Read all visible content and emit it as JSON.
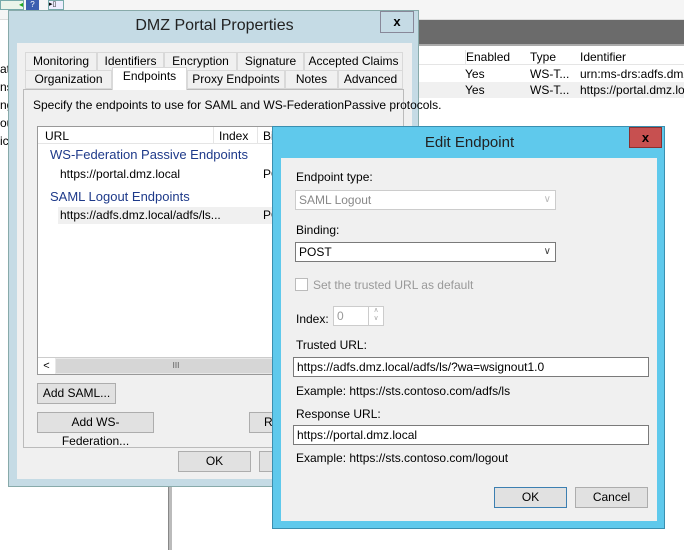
{
  "background": {
    "toolbar_icons": [
      "back-arrow-icon",
      "help-icon",
      "show-pane-icon"
    ],
    "left_fragments": [
      "at",
      "ns",
      "ng",
      "ou",
      "ic"
    ],
    "table": {
      "columns": [
        "Enabled",
        "Type",
        "Identifier"
      ],
      "rows": [
        [
          "Yes",
          "WS-T...",
          "urn:ms-drs:adfs.dmz.lo"
        ],
        [
          "Yes",
          "WS-T...",
          "https://portal.dmz.loca"
        ]
      ]
    }
  },
  "properties_dialog": {
    "title": "DMZ Portal Properties",
    "close": "x",
    "tabs_row1": [
      "Monitoring",
      "Identifiers",
      "Encryption",
      "Signature",
      "Accepted Claims"
    ],
    "tabs_row2": [
      "Organization",
      "Endpoints",
      "Proxy Endpoints",
      "Notes",
      "Advanced"
    ],
    "active_tab": "Endpoints",
    "description": "Specify the endpoints to use for SAML and WS-FederationPassive protocols.",
    "list": {
      "columns": [
        "URL",
        "Index",
        "Bi"
      ],
      "groups": [
        {
          "name": "WS-Federation Passive Endpoints",
          "items": [
            {
              "url": "https://portal.dmz.local",
              "binding": "PO"
            }
          ]
        },
        {
          "name": "SAML Logout Endpoints",
          "items": [
            {
              "url": "https://adfs.dmz.local/adfs/ls...",
              "binding": "PO"
            }
          ]
        }
      ],
      "scroll_left": "<",
      "scroll_thumb": "III"
    },
    "add_saml": "Add SAML...",
    "add_wsfed": "Add WS-Federation...",
    "remove_partial": "Re",
    "ok": "OK",
    "cancel_partial": "C"
  },
  "edit_dialog": {
    "title": "Edit Endpoint",
    "close": "x",
    "endpoint_type_label": "Endpoint type:",
    "endpoint_type_value": "SAML Logout",
    "binding_label": "Binding:",
    "binding_value": "POST",
    "default_checkbox_label": "Set the trusted URL as default",
    "default_checked": false,
    "index_label": "Index:",
    "index_value": "0",
    "trusted_url_label": "Trusted URL:",
    "trusted_url_value": "https://adfs.dmz.local/adfs/ls/?wa=wsignout1.0",
    "trusted_example": "Example: https://sts.contoso.com/adfs/ls",
    "response_url_label": "Response URL:",
    "response_url_value": "https://portal.dmz.local",
    "response_example": "Example: https://sts.contoso.com/logout",
    "ok": "OK",
    "cancel": "Cancel",
    "accent": "#5fc9ec",
    "close_color": "#c75050"
  }
}
